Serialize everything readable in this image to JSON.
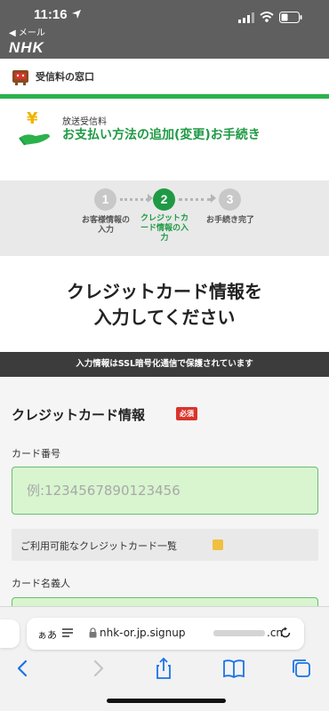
{
  "status_bar": {
    "time": "11:16",
    "back_app": "◀ メール"
  },
  "nhk": {
    "logo": "NHK"
  },
  "jushin": {
    "title": "受信料の窓口"
  },
  "service": {
    "small": "放送受信料",
    "big": "お支払い方法の追加(変更)お手続き"
  },
  "stepper": {
    "steps": [
      {
        "number": "1",
        "label": "お客様情報の入力",
        "state": "done"
      },
      {
        "number": "2",
        "label": "クレジットカード情報の入力",
        "state": "current"
      },
      {
        "number": "3",
        "label": "お手続き完了",
        "state": "pending"
      }
    ]
  },
  "page": {
    "title_line1": "クレジットカード情報を",
    "title_line2": "入力してください"
  },
  "ssl_notice": "入力情報はSSL暗号化通信で保護されています",
  "form": {
    "section_title": "クレジットカード情報",
    "required_badge": "必須",
    "card_number_label": "カード番号",
    "card_number_placeholder": "例:1234567890123456",
    "card_list_label": "ご利用可能なクレジットカード一覧",
    "card_holder_label": "カード名義人"
  },
  "browser": {
    "aa": "ぁあ",
    "url_prefix": "nhk-or.jp.signup",
    "url_suffix": ".cn"
  },
  "colors": {
    "brand_green": "#1f9a44",
    "accent_red": "#d9342b",
    "input_bg": "#d8f5cf"
  }
}
